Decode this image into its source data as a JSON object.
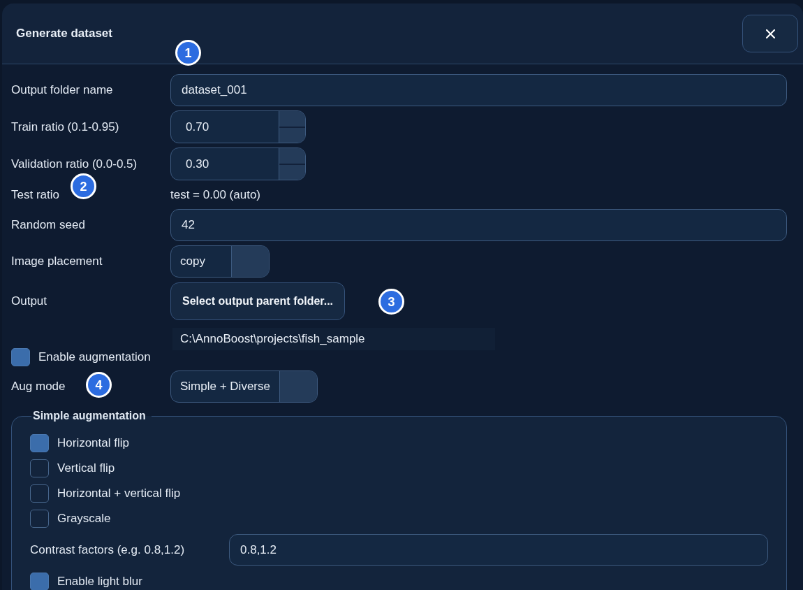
{
  "dialog": {
    "title": "Generate dataset"
  },
  "fields": [
    {
      "kind": "text",
      "label": "Output folder name",
      "value": "dataset_001"
    },
    {
      "kind": "spin",
      "label": "Train ratio (0.1-0.95)",
      "value": "0.70"
    },
    {
      "kind": "spin",
      "label": "Validation ratio (0.0-0.5)",
      "value": "0.30"
    },
    {
      "kind": "readout",
      "label": "Test ratio",
      "value": "test = 0.00 (auto)"
    },
    {
      "kind": "text",
      "label": "Random seed",
      "value": "42"
    },
    {
      "kind": "combo",
      "label": "Image placement",
      "value": "copy"
    },
    {
      "kind": "button",
      "label": "Output",
      "value": "Select output parent folder..."
    },
    {
      "kind": "path",
      "value": "C:\\AnnoBoost\\projects\\fish_sample"
    },
    {
      "kind": "checkbox",
      "label": "Enable augmentation",
      "checked": true
    },
    {
      "kind": "combo",
      "label": "Aug mode",
      "value": "Simple + Diverse"
    }
  ],
  "simple_augmentation": {
    "title": "Simple augmentation",
    "items": [
      {
        "kind": "checkbox",
        "label": "Horizontal flip",
        "checked": true
      },
      {
        "kind": "checkbox",
        "label": "Vertical flip",
        "checked": false
      },
      {
        "kind": "checkbox",
        "label": "Horizontal + vertical flip",
        "checked": false
      },
      {
        "kind": "checkbox",
        "label": "Grayscale",
        "checked": false
      },
      {
        "kind": "text",
        "label": "Contrast factors (e.g. 0.8,1.2)",
        "value": "0.8,1.2"
      },
      {
        "kind": "checkbox",
        "label": "Enable light blur",
        "checked": true
      }
    ]
  },
  "callouts": [
    {
      "number": "1"
    },
    {
      "number": "2"
    },
    {
      "number": "3"
    },
    {
      "number": "4"
    }
  ]
}
